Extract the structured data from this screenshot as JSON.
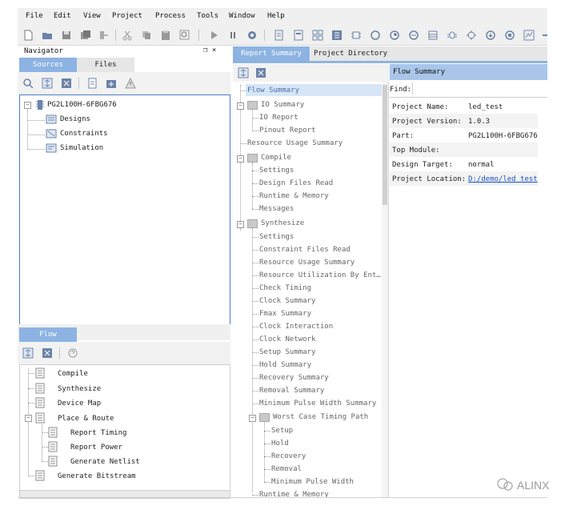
{
  "menu": [
    "File",
    "Edit",
    "View",
    "Project",
    "Process",
    "Tools",
    "Window",
    "Help"
  ],
  "navigator": {
    "title": "Navigator",
    "pin_symbol": "❒ ×",
    "tabs": [
      "Sources",
      "Files"
    ],
    "tree": {
      "root": "PG2L100H-6FBG676",
      "children": [
        "Designs",
        "Constraints",
        "Simulation"
      ]
    }
  },
  "flow": {
    "tab": "Flow",
    "items": [
      "Compile",
      "Synthesize",
      "Device Map",
      "Place & Route"
    ],
    "place_route_children": [
      "Report Timing",
      "Report Power",
      "Generate Netlist"
    ],
    "last": "Generate Bitstream"
  },
  "report": {
    "tabs": [
      "Report Summary",
      "Project Directory"
    ],
    "tree": {
      "flow_summary": "Flow Summary",
      "io_summary": "IO Summary",
      "io_children": [
        "IO Report",
        "Pinout Report"
      ],
      "resource_usage": "Resource Usage Summary",
      "compile": "Compile",
      "compile_children": [
        "Settings",
        "Design Files Read",
        "Runtime & Memory",
        "Messages"
      ],
      "synthesize": "Synthesize",
      "synth_children": [
        "Settings",
        "Constraint Files Read",
        "Resource Usage Summary",
        "Resource Utilization By Ent…",
        "Check Timing",
        "Clock Summary",
        "Fmax Summary",
        "Clock Interaction",
        "Clock Network",
        "Setup Summary",
        "Hold Summary",
        "Recovery Summary",
        "Removal Summary",
        "Minimum Pulse Width Summary"
      ],
      "worst_case": "Worst Case Timing Path",
      "worst_children": [
        "Setup",
        "Hold",
        "Recovery",
        "Removal",
        "Minimum Pulse Width"
      ],
      "runtime": "Runtime & Memory"
    }
  },
  "summary": {
    "title": "Flow Summary",
    "find_label": "Find:",
    "rows": [
      {
        "label": "Project Name:",
        "value": "led_test"
      },
      {
        "label": "Project Version:",
        "value": "1.0.3"
      },
      {
        "label": "Part:",
        "value": "PG2L100H-6FBG676"
      },
      {
        "label": "Top Module:",
        "value": ""
      },
      {
        "label": "Design Target:",
        "value": "normal"
      },
      {
        "label": "Project Location:",
        "value": "D:/demo/led_test"
      }
    ]
  },
  "watermark": "ALINX",
  "colors": {
    "accent": "#8db3e2",
    "selected": "#d6e6f7",
    "link": "#1a4fc4"
  }
}
